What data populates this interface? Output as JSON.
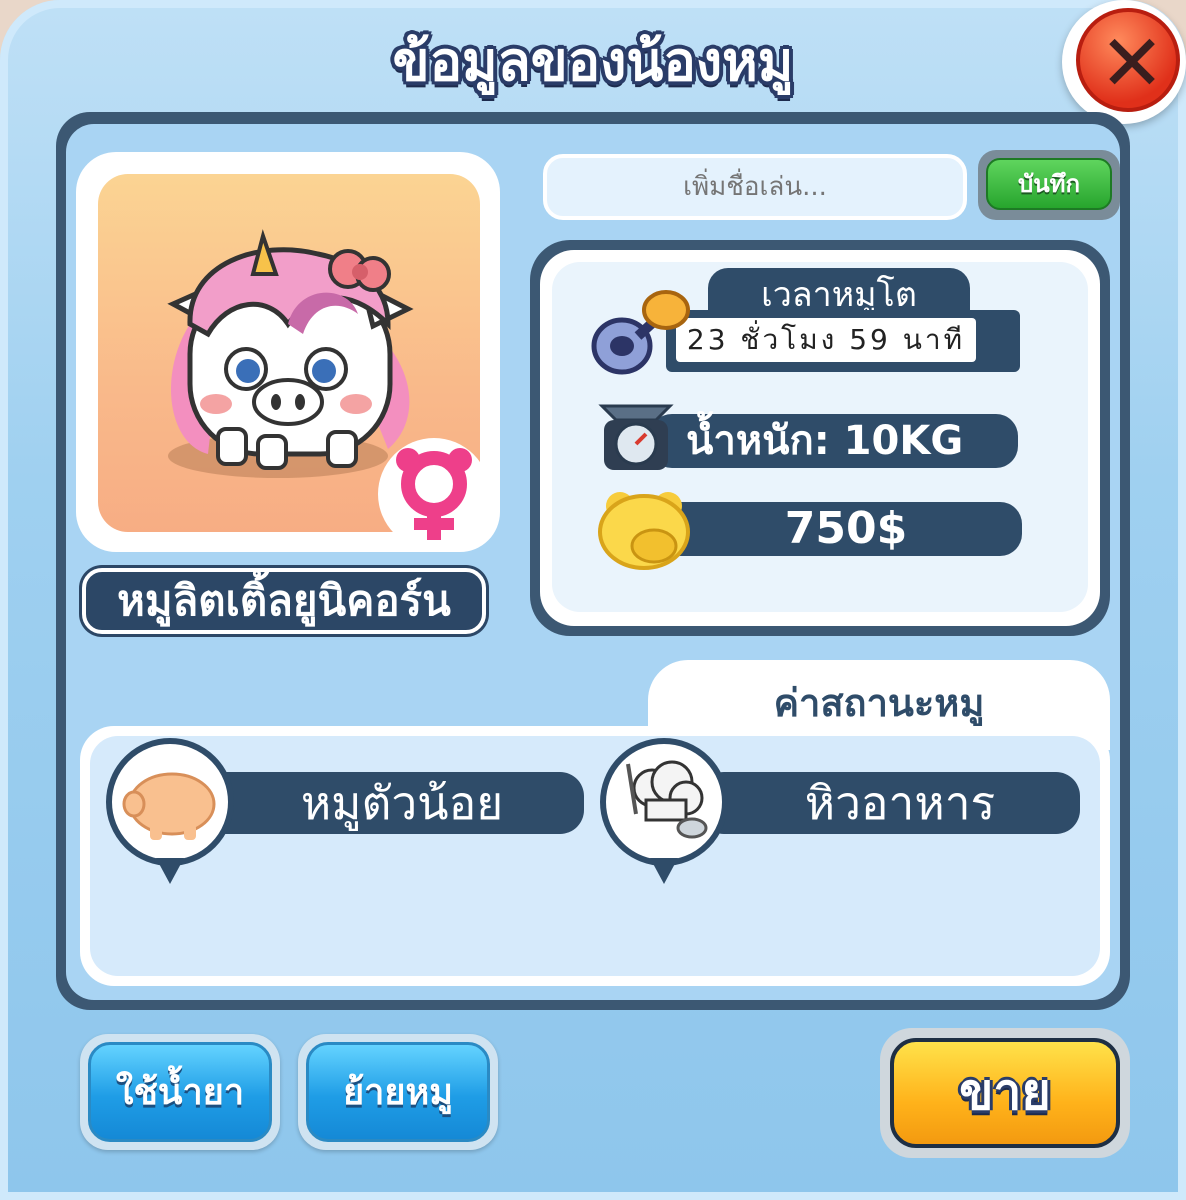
{
  "header": {
    "title": "ข้อมูลของน้องหมู"
  },
  "close_button": {
    "glyph": "✕",
    "icon": "close-icon"
  },
  "pig": {
    "name": "หมูลิตเติ้ลยูนิคอร์น",
    "gender_icon": "female-icon"
  },
  "nickname": {
    "placeholder": "เพิ่มชื่อเล่น...",
    "value": "",
    "save_label": "บันทึก"
  },
  "stats": {
    "grow_time_label": "เวลาหมูโต",
    "grow_time_value": "23 ชั่วโมง 59 นาที",
    "weight": "น้ำหนัก: 10KG",
    "price": "750$"
  },
  "status": {
    "tab_label": "ค่าสถานะหมู",
    "traits": [
      {
        "label": "หมูตัวน้อย",
        "icon": "piglet-icon"
      },
      {
        "label": "หิวอาหาร",
        "icon": "chef-hat-icon"
      }
    ]
  },
  "actions": {
    "potion": "ใช้น้ำยา",
    "move": "ย้ายหมู",
    "sell": "ขาย"
  },
  "colors": {
    "panel_dark": "#3c5873",
    "panel_light": "#a9d4f3",
    "accent_green": "#27a52d",
    "accent_blue": "#1f9de6",
    "accent_orange": "#ffb21a",
    "close_red": "#e0301a"
  }
}
